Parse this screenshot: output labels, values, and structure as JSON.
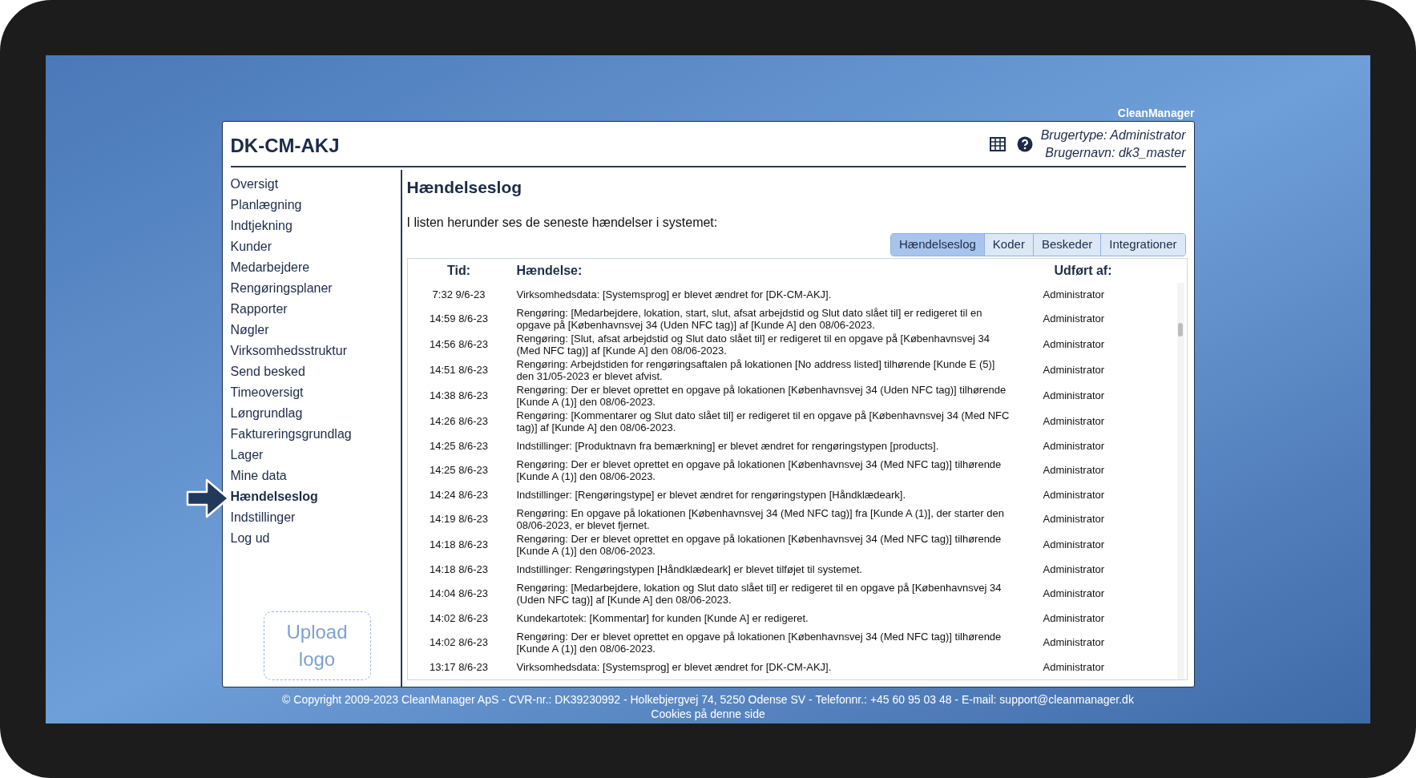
{
  "brand": "CleanManager",
  "header": {
    "title": "DK-CM-AKJ",
    "user_type": "Brugertype: Administrator",
    "user_name": "Brugernavn: dk3_master"
  },
  "sidebar": {
    "items": [
      {
        "label": "Oversigt",
        "selected": false
      },
      {
        "label": "Planlægning",
        "selected": false
      },
      {
        "label": "Indtjekning",
        "selected": false
      },
      {
        "label": "Kunder",
        "selected": false
      },
      {
        "label": "Medarbejdere",
        "selected": false
      },
      {
        "label": "Rengøringsplaner",
        "selected": false
      },
      {
        "label": "Rapporter",
        "selected": false
      },
      {
        "label": "Nøgler",
        "selected": false
      },
      {
        "label": "Virksomhedsstruktur",
        "selected": false
      },
      {
        "label": "Send besked",
        "selected": false
      },
      {
        "label": "Timeoversigt",
        "selected": false
      },
      {
        "label": "Løngrundlag",
        "selected": false
      },
      {
        "label": "Faktureringsgrundlag",
        "selected": false
      },
      {
        "label": "Lager",
        "selected": false
      },
      {
        "label": "Mine data",
        "selected": false
      },
      {
        "label": "Hændelseslog",
        "selected": true
      },
      {
        "label": "Indstillinger",
        "selected": false
      },
      {
        "label": "Log ud",
        "selected": false
      }
    ],
    "upload_logo": "Upload logo"
  },
  "content": {
    "heading": "Hændelseslog",
    "intro": "I listen herunder ses de seneste hændelser i systemet:",
    "tabs": [
      {
        "label": "Hændelseslog",
        "selected": true
      },
      {
        "label": "Koder",
        "selected": false
      },
      {
        "label": "Beskeder",
        "selected": false
      },
      {
        "label": "Integrationer",
        "selected": false
      }
    ],
    "table": {
      "columns": [
        "Tid:",
        "Hændelse:",
        "Udført af:"
      ],
      "rows": [
        [
          "7:32 9/6-23",
          "Virksomhedsdata: [Systemsprog] er blevet ændret for [DK-CM-AKJ].",
          "Administrator"
        ],
        [
          "14:59 8/6-23",
          "Rengøring: [Medarbejdere, lokation, start, slut, afsat arbejdstid og Slut dato slået til] er redigeret til en opgave på [Københavnsvej 34 (Uden NFC tag)] af [Kunde A] den 08/06-2023.",
          "Administrator"
        ],
        [
          "14:56 8/6-23",
          "Rengøring: [Slut, afsat arbejdstid og Slut dato slået til] er redigeret til en opgave på [Københavnsvej 34 (Med NFC tag)] af [Kunde A] den 08/06-2023.",
          "Administrator"
        ],
        [
          "14:51 8/6-23",
          "Rengøring: Arbejdstiden for rengøringsaftalen på lokationen [No address listed] tilhørende [Kunde E (5)] den 31/05-2023 er blevet afvist.",
          "Administrator"
        ],
        [
          "14:38 8/6-23",
          "Rengøring: Der er blevet oprettet en opgave på lokationen [Københavnsvej 34 (Uden NFC tag)] tilhørende [Kunde A (1)] den 08/06-2023.",
          "Administrator"
        ],
        [
          "14:26 8/6-23",
          "Rengøring: [Kommentarer og Slut dato slået til] er redigeret til en opgave på [Københavnsvej 34 (Med NFC tag)] af [Kunde A] den 08/06-2023.",
          "Administrator"
        ],
        [
          "14:25 8/6-23",
          "Indstillinger: [Produktnavn fra bemærkning] er blevet ændret for rengøringstypen [products].",
          "Administrator"
        ],
        [
          "14:25 8/6-23",
          "Rengøring: Der er blevet oprettet en opgave på lokationen [Københavnsvej 34 (Med NFC tag)] tilhørende [Kunde A (1)] den 08/06-2023.",
          "Administrator"
        ],
        [
          "14:24 8/6-23",
          "Indstillinger: [Rengøringstype] er blevet ændret for rengøringstypen [Håndklædeark].",
          "Administrator"
        ],
        [
          "14:19 8/6-23",
          "Rengøring: En opgave på lokationen [Københavnsvej 34 (Med NFC tag)] fra [Kunde A (1)], der starter den 08/06-2023, er blevet fjernet.",
          "Administrator"
        ],
        [
          "14:18 8/6-23",
          "Rengøring: Der er blevet oprettet en opgave på lokationen [Københavnsvej 34 (Med NFC tag)] tilhørende [Kunde A (1)] den 08/06-2023.",
          "Administrator"
        ],
        [
          "14:18 8/6-23",
          "Indstillinger: Rengøringstypen [Håndklædeark] er blevet tilføjet til systemet.",
          "Administrator"
        ],
        [
          "14:04 8/6-23",
          "Rengøring: [Medarbejdere, lokation og Slut dato slået til] er redigeret til en opgave på [Københavnsvej 34 (Uden NFC tag)] af [Kunde A] den 08/06-2023.",
          "Administrator"
        ],
        [
          "14:02 8/6-23",
          "Kundekartotek: [Kommentar] for kunden [Kunde A] er redigeret.",
          "Administrator"
        ],
        [
          "14:02 8/6-23",
          "Rengøring: Der er blevet oprettet en opgave på lokationen [Københavnsvej 34 (Med NFC tag)] tilhørende [Kunde A (1)] den 08/06-2023.",
          "Administrator"
        ],
        [
          "13:17 8/6-23",
          "Virksomhedsdata: [Systemsprog] er blevet ændret for [DK-CM-AKJ].",
          "Administrator"
        ]
      ]
    }
  },
  "footer": {
    "copyright": "© Copyright 2009-2023 CleanManager ApS - CVR-nr.: DK39230992 - Holkebjergvej 74, 5250 Odense SV - Telefonnr.: +45 60 95 03 48 - E-mail: support@cleanmanager.dk",
    "cookies": "Cookies på denne side"
  }
}
